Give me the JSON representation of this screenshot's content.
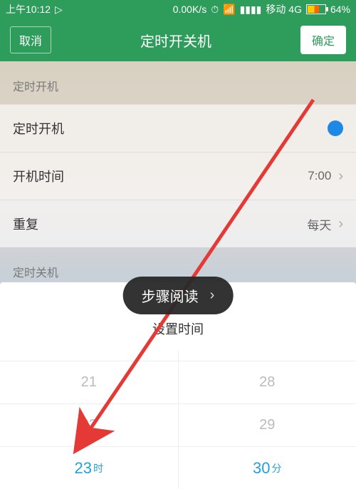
{
  "status": {
    "time": "上午10:12",
    "net_speed": "0.00K/s",
    "carrier": "移动 4G",
    "battery_pct": "64%"
  },
  "header": {
    "cancel": "取消",
    "title": "定时开关机",
    "confirm": "确定"
  },
  "sections": {
    "on": {
      "label": "定时开机",
      "row_toggle": "定时开机",
      "row_time_label": "开机时间",
      "row_time_value": "7:00",
      "row_repeat_label": "重复",
      "row_repeat_value": "每天"
    },
    "off": {
      "label": "定时关机"
    }
  },
  "step_pill": "步骤阅读",
  "sheet": {
    "title": "设置时间",
    "hour": {
      "m2": "21",
      "m1": "22",
      "sel": "23",
      "unit": "时"
    },
    "minute": {
      "m2": "28",
      "m1": "29",
      "sel": "30",
      "unit": "分"
    }
  }
}
